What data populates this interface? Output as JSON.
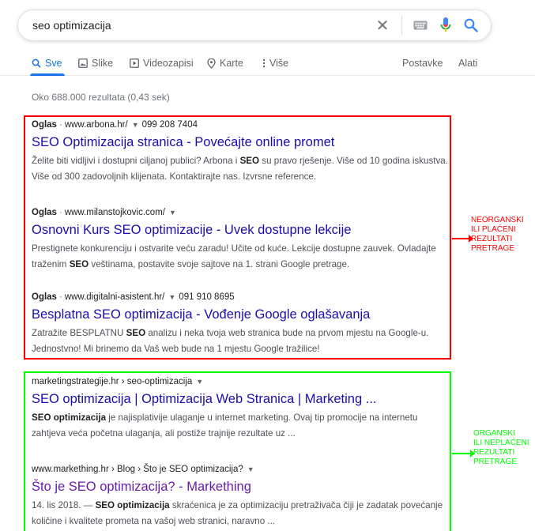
{
  "search": {
    "query": "seo optimizacija"
  },
  "tabs": [
    {
      "label": "Sve",
      "icon": "search-icon",
      "active": true
    },
    {
      "label": "Slike",
      "icon": "image-icon"
    },
    {
      "label": "Videozapisi",
      "icon": "video-icon"
    },
    {
      "label": "Karte",
      "icon": "map-pin-icon"
    },
    {
      "label": "Više",
      "icon": "more-vertical-icon"
    }
  ],
  "tools": {
    "settings": "Postavke",
    "tools": "Alati"
  },
  "stats": "Oko 688.000 rezultata (0,43 sek)",
  "ads": [
    {
      "label": "Oglas",
      "url": "www.arbona.hr/",
      "phone": "099 208 7404",
      "title": "SEO Optimizacija stranica - Povećajte online promet",
      "snippet_parts": [
        "Želite biti vidljivi i dostupni ciljanoj publici? Arbona i ",
        "SEO",
        " su pravo rješenje. Više od 10 godina iskustva. Više od 300 zadovoljnih klijenata. Kontaktirajte nas. Izvrsne reference."
      ]
    },
    {
      "label": "Oglas",
      "url": "www.milanstojkovic.com/",
      "phone": "",
      "title": "Osnovni Kurs SEO optimizacije - Uvek dostupne lekcije",
      "snippet_parts": [
        "Prestignete konkurenciju i ostvarite veću zaradu! Učite od kuće. Lekcije dostupne zauvek. Ovladajte traženim ",
        "SEO",
        " veštinama, postavite svoje sajtove na 1. strani Google pretrage."
      ]
    },
    {
      "label": "Oglas",
      "url": "www.digitalni-asistent.hr/",
      "phone": "091 910 8695",
      "title": "Besplatna SEO optimizacija - Vođenje Google oglašavanja",
      "snippet_parts": [
        "Zatražite BESPLATNU ",
        "SEO",
        " analizu i neka tvoja web stranica bude na prvom mjestu na Google-u. Jednostvno! Mi brinemo da Vaš web bude na 1 mjestu Google tražilice!"
      ]
    }
  ],
  "organic": [
    {
      "breadcrumb": "marketingstrategije.hr › seo-optimizacija",
      "title": "SEO optimizacija | Optimizacija Web Stranica | Marketing ...",
      "snippet_parts": [
        "",
        "SEO optimizacija",
        " je najisplativije ulaganje u internet marketing. Ovaj tip promocije na internetu zahtjeva veća početna ulaganja, ali postiže trajnije rezultate uz ..."
      ]
    },
    {
      "breadcrumb": "www.markething.hr › Blog › Što je SEO optimizacija?",
      "title": "Što je SEO optimizacija? - Markething",
      "snippet_parts": [
        "14. lis 2018. — ",
        "SEO optimizacija",
        " skraćenica je za optimizaciju pretraživača čiji je zadatak povećanje količine i kvalitete prometa na vašoj web stranici, naravno ..."
      ]
    }
  ],
  "annotations": {
    "paid": [
      "NEORGANSKI",
      "ILI PLAĆENI",
      "REZULTATI",
      "PRETRAGE"
    ],
    "organic": [
      "ORGANSKI",
      "ILI NEPLAĆENI",
      "REZULTATI",
      "PRETRAGE"
    ],
    "paid_color": "#ff0000",
    "organic_color": "#00ff00"
  },
  "colors": {
    "link": "#1a0dab",
    "accent": "#1a73e8",
    "snippet": "#4d5156"
  }
}
